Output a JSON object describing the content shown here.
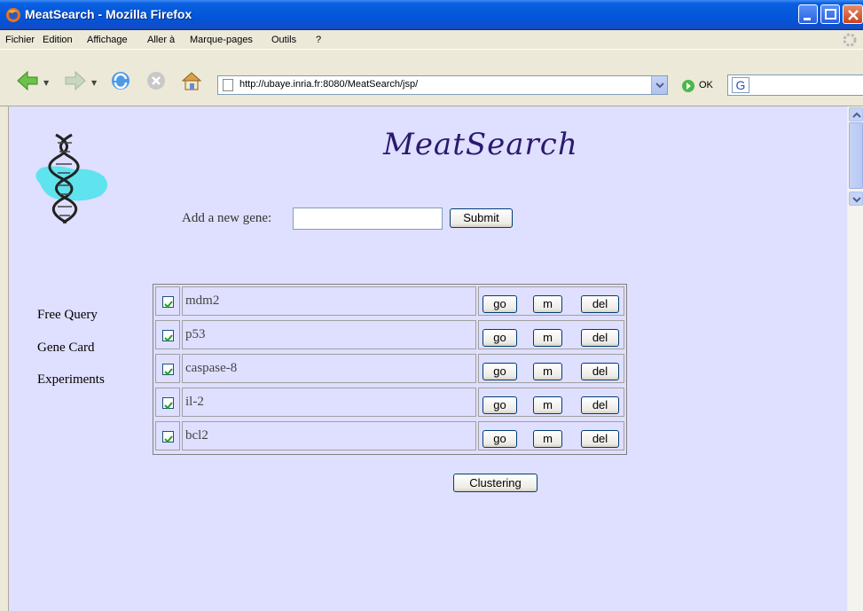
{
  "window": {
    "title": "MeatSearch - Mozilla Firefox"
  },
  "menu": {
    "items": [
      "Fichier",
      "Edition",
      "Affichage",
      "Aller à",
      "Marque-pages",
      "Outils",
      "?"
    ]
  },
  "navbar": {
    "url": "http://ubaye.inria.fr:8080/MeatSearch/jsp/",
    "go_label": "OK"
  },
  "page": {
    "app_title": "MeatSearch",
    "add_gene_label": "Add a new gene:",
    "add_gene_value": "",
    "submit_label": "Submit",
    "side_links": [
      "Free Query",
      "Gene Card",
      "Experiments"
    ],
    "genes": [
      {
        "name": "mdm2",
        "checked": true
      },
      {
        "name": "p53",
        "checked": true
      },
      {
        "name": "caspase-8",
        "checked": true
      },
      {
        "name": "il-2",
        "checked": true
      },
      {
        "name": "bcl2",
        "checked": true
      }
    ],
    "row_buttons": {
      "go": "go",
      "m": "m",
      "del": "del"
    },
    "clustering_label": "Clustering"
  },
  "colors": {
    "page_background": "#dfdfff",
    "title_color": "#2a1a6e",
    "chrome": "#ece9d8"
  }
}
